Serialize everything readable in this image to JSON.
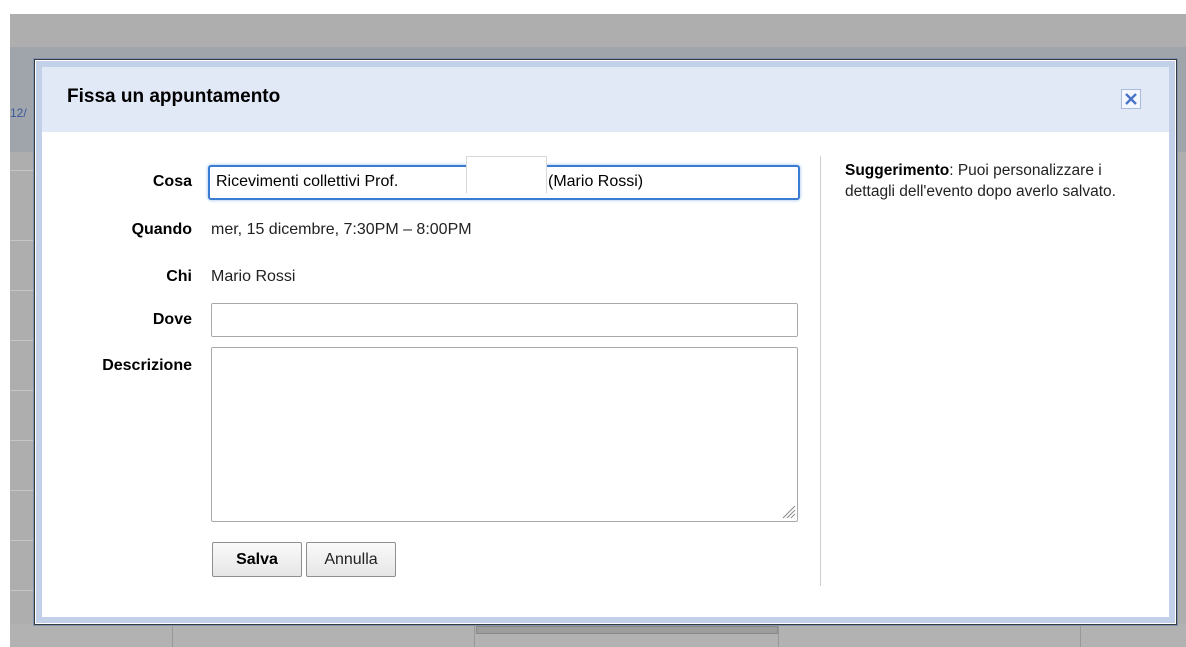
{
  "background": {
    "date_fragment": "12/"
  },
  "dialog": {
    "title": "Fissa un appuntamento",
    "close_icon": "close-x-icon",
    "fields": {
      "what_label": "Cosa",
      "what_value_start": "Ricevimenti collettivi Prof.",
      "what_value_end": "(Mario Rossi)",
      "when_label": "Quando",
      "when_value": "mer, 15 dicembre, 7:30PM – 8:00PM",
      "who_label": "Chi",
      "who_value": "Mario Rossi",
      "where_label": "Dove",
      "where_value": "",
      "description_label": "Descrizione",
      "description_value": ""
    },
    "buttons": {
      "save": "Salva",
      "cancel": "Annulla"
    },
    "tip": {
      "title": "Suggerimento",
      "text": ": Puoi personalizzare i dettagli dell'evento dopo averlo salvato."
    }
  },
  "colors": {
    "title_bar": "#e1e8f6",
    "frame": "#c3d1e8",
    "focus_border": "#3b7bd1",
    "overlay": "#aeaeae"
  }
}
